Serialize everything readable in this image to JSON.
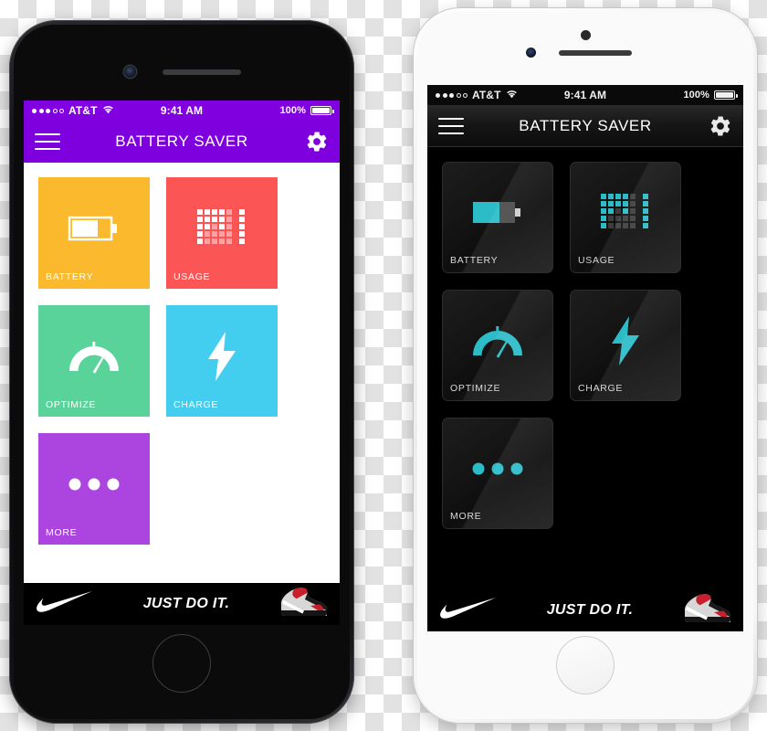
{
  "app": {
    "title": "BATTERY SAVER",
    "menu_icon": "hamburger-menu-icon",
    "settings_icon": "gear-icon"
  },
  "status_bar": {
    "carrier": "AT&T",
    "signal_icon": "signal-dots-icon",
    "wifi_icon": "wifi-icon",
    "time": "9:41 AM",
    "battery_percent": "100%",
    "battery_icon": "battery-full-icon"
  },
  "tiles": [
    {
      "label": "BATTERY",
      "icon": "battery-icon",
      "color": "#FBBA2E"
    },
    {
      "label": "USAGE",
      "icon": "usage-grid-icon",
      "color": "#FB5556"
    },
    {
      "label": "OPTIMIZE",
      "icon": "speedometer-icon",
      "color": "#59D399"
    },
    {
      "label": "CHARGE",
      "icon": "lightning-bolt-icon",
      "color": "#43CEF0"
    },
    {
      "label": "MORE",
      "icon": "ellipsis-icon",
      "color": "#AC45E0"
    }
  ],
  "ad": {
    "brand_icon": "nike-swoosh-icon",
    "slogan": "JUST DO IT.",
    "product_icon": "sneaker-icon"
  },
  "themes": {
    "light": {
      "name": "light-theme",
      "header_color": "#7E00DE",
      "status_color": "#8000E0",
      "background": "#FFFFFF"
    },
    "dark": {
      "name": "dark-theme",
      "header_color": "#161616",
      "status_color": "#0A0A0A",
      "background": "#000000",
      "accent": "#2BBCC8"
    }
  },
  "devices": [
    {
      "name": "black-iphone",
      "theme": "light"
    },
    {
      "name": "white-iphone",
      "theme": "dark"
    }
  ]
}
